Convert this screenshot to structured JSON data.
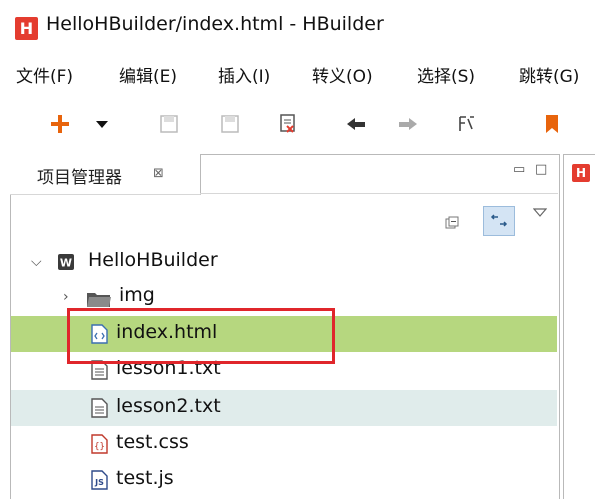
{
  "window": {
    "title": "HelloHBuilder/index.html  -  HBuilder",
    "logo_letter": "H"
  },
  "menu": [
    {
      "label": "文件(F)"
    },
    {
      "label": "编辑(E)"
    },
    {
      "label": "插入(I)"
    },
    {
      "label": "转义(O)"
    },
    {
      "label": "选择(S)"
    },
    {
      "label": "跳转(G)"
    }
  ],
  "toolbar": {
    "icons": [
      "plus-icon",
      "dropdown-arrow-icon",
      "save-icon",
      "save-all-icon",
      "close-file-icon",
      "back-arrow-icon",
      "forward-arrow-icon",
      "format-icon",
      "bookmark-icon"
    ]
  },
  "panel": {
    "tab_label": "项目管理器",
    "close_symbol": "⊠",
    "minimize_symbol": "▭",
    "maximize_symbol": "□"
  },
  "tree": {
    "project": "HelloHBuilder",
    "items": [
      {
        "label": "img",
        "type": "folder"
      },
      {
        "label": "index.html",
        "type": "html",
        "selected": true
      },
      {
        "label": "lesson1.txt",
        "type": "txt"
      },
      {
        "label": "lesson2.txt",
        "type": "txt",
        "hover": true
      },
      {
        "label": "test.css",
        "type": "css"
      },
      {
        "label": "test.js",
        "type": "js"
      }
    ]
  },
  "colors": {
    "accent_red": "#e43c2f",
    "selection_green": "#b6d77f",
    "hover_row": "#e0eceb",
    "highlight_box": "#e0262b",
    "toolbar_orange": "#e8640c"
  }
}
